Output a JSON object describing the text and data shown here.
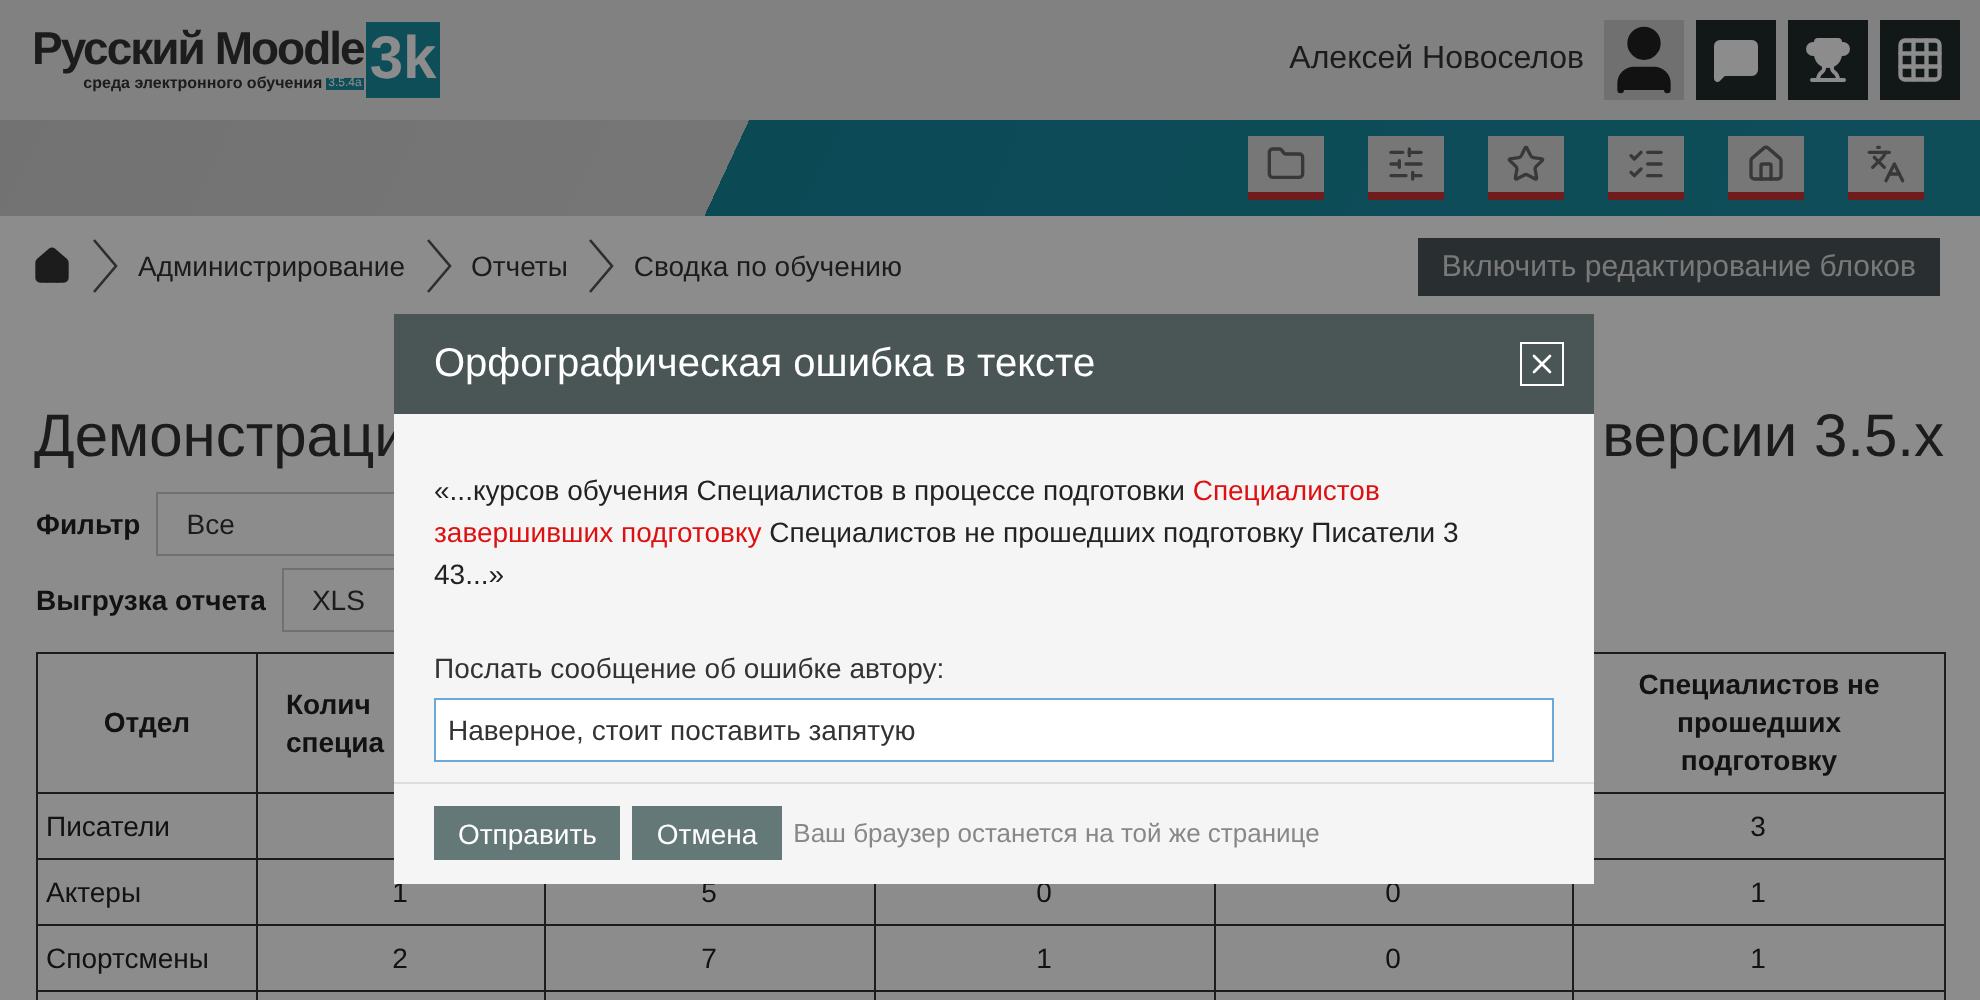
{
  "header": {
    "logo": {
      "name": "Русский Moodle",
      "mark": "3k",
      "tagline": "среда электронного обучения",
      "version": "3.5.4a"
    },
    "user_name": "Алексей Новоселов"
  },
  "breadcrumbs": [
    "Администрирование",
    "Отчеты",
    "Сводка по обучению"
  ],
  "edit_button": "Включить редактирование блоков",
  "page_title": {
    "left": "Демонстраци",
    "right": "версии 3.5.x"
  },
  "filter": {
    "label": "Фильтр",
    "value": "Все"
  },
  "export": {
    "label": "Выгрузка отчета",
    "value": "XLS"
  },
  "table": {
    "columns": [
      "Отдел",
      "Колич\nспециа",
      "",
      "",
      "",
      "Специалистов не прошедших подготовку"
    ],
    "rows": [
      [
        "Писатели",
        "",
        "",
        "",
        "",
        "3"
      ],
      [
        "Актеры",
        "1",
        "5",
        "0",
        "0",
        "1"
      ],
      [
        "Спортсмены",
        "2",
        "7",
        "1",
        "0",
        "1"
      ],
      [
        "",
        "",
        "",
        "",
        "",
        ""
      ]
    ]
  },
  "dialog": {
    "title": "Орфографическая ошибка в тексте",
    "quote": [
      {
        "kind": "plain",
        "text": "«...курсов обучения Специалистов в процессе подготовки "
      },
      {
        "kind": "highlight",
        "text": "Специалистов завершивших подготовку"
      },
      {
        "kind": "plain",
        "text": " Специалистов не прошедших подготовку Писатели 3 43...»"
      }
    ],
    "field_label": "Послать сообщение об ошибке автору:",
    "field_value": "Наверное, стоит поставить запятую",
    "buttons": [
      "Отправить",
      "Отмена"
    ],
    "hint": "Ваш браузер останется на той же странице"
  }
}
